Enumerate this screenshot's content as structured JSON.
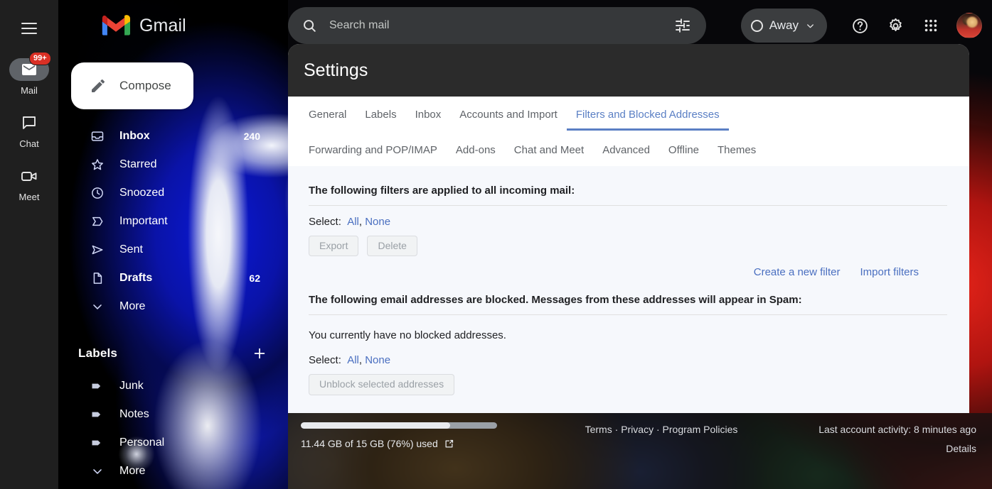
{
  "app": {
    "brand": "Gmail",
    "menu_icon": "hamburger-menu-icon"
  },
  "search": {
    "placeholder": "Search mail",
    "value": "",
    "search_icon": "search-icon",
    "options_icon": "search-options-tune-icon"
  },
  "topbar": {
    "status_chip": {
      "label": "Away",
      "icon": "status-circle-icon",
      "chevron": "chevron-down-icon"
    },
    "help_icon": "help-question-icon",
    "settings_icon": "gear-icon",
    "apps_icon": "google-apps-grid-icon",
    "avatar": "user-avatar"
  },
  "rail": {
    "items": [
      {
        "label": "Mail",
        "icon": "mail-envelope-icon",
        "badge": "99+",
        "active": true
      },
      {
        "label": "Chat",
        "icon": "chat-bubble-icon",
        "badge": "",
        "active": false
      },
      {
        "label": "Meet",
        "icon": "video-camera-icon",
        "badge": "",
        "active": false
      }
    ]
  },
  "nav": {
    "compose": {
      "label": "Compose",
      "icon": "pencil-compose-icon"
    },
    "items": [
      {
        "label": "Inbox",
        "count": "240",
        "icon": "inbox-icon",
        "bold": true
      },
      {
        "label": "Starred",
        "count": "",
        "icon": "star-icon",
        "bold": false
      },
      {
        "label": "Snoozed",
        "count": "",
        "icon": "clock-icon",
        "bold": false
      },
      {
        "label": "Important",
        "count": "",
        "icon": "important-label-icon",
        "bold": false
      },
      {
        "label": "Sent",
        "count": "",
        "icon": "send-icon",
        "bold": false
      },
      {
        "label": "Drafts",
        "count": "62",
        "icon": "draft-file-icon",
        "bold": true
      },
      {
        "label": "More",
        "count": "",
        "icon": "chevron-down-icon",
        "bold": false
      }
    ],
    "labels_section": {
      "title": "Labels",
      "add_icon": "plus-add-label-icon",
      "items": [
        {
          "label": "Junk",
          "icon": "label-tag-icon"
        },
        {
          "label": "Notes",
          "icon": "label-tag-icon"
        },
        {
          "label": "Personal",
          "icon": "label-tag-icon"
        },
        {
          "label": "More",
          "icon": "chevron-down-icon"
        }
      ]
    }
  },
  "settings": {
    "title": "Settings",
    "tabs_row1": [
      {
        "label": "General",
        "active": false
      },
      {
        "label": "Labels",
        "active": false
      },
      {
        "label": "Inbox",
        "active": false
      },
      {
        "label": "Accounts and Import",
        "active": false
      },
      {
        "label": "Filters and Blocked Addresses",
        "active": true
      }
    ],
    "tabs_row2": [
      {
        "label": "Forwarding and POP/IMAP",
        "active": false
      },
      {
        "label": "Add-ons",
        "active": false
      },
      {
        "label": "Chat and Meet",
        "active": false
      },
      {
        "label": "Advanced",
        "active": false
      },
      {
        "label": "Offline",
        "active": false
      },
      {
        "label": "Themes",
        "active": false
      }
    ],
    "filters_section": {
      "heading": "The following filters are applied to all incoming mail:",
      "select_label": "Select:",
      "select_all": "All",
      "select_comma": ", ",
      "select_none": "None",
      "export_button": "Export",
      "delete_button": "Delete",
      "create_filter_link": "Create a new filter",
      "import_filters_link": "Import filters"
    },
    "blocked_section": {
      "heading": "The following email addresses are blocked. Messages from these addresses will appear in Spam:",
      "empty_text": "You currently have no blocked addresses.",
      "select_label": "Select:",
      "select_all": "All",
      "select_comma": ", ",
      "select_none": "None",
      "unblock_button": "Unblock selected addresses"
    }
  },
  "footer": {
    "storage_text": "11.44 GB of 15 GB (76%) used",
    "storage_percent": 76,
    "storage_external_icon": "external-link-icon",
    "terms": "Terms",
    "sep1": "·",
    "privacy": "Privacy",
    "sep2": "·",
    "program_policies": "Program Policies",
    "last_activity": "Last account activity: 8 minutes ago",
    "details": "Details"
  },
  "colors": {
    "accent_blue": "#5a7fc4",
    "link_blue": "#4a6fc0",
    "badge_red": "#d93025",
    "rail_bg": "#1f1f1f",
    "settings_header_bg": "#2b2b2b",
    "settings_body_bg": "#f6f8fc"
  }
}
